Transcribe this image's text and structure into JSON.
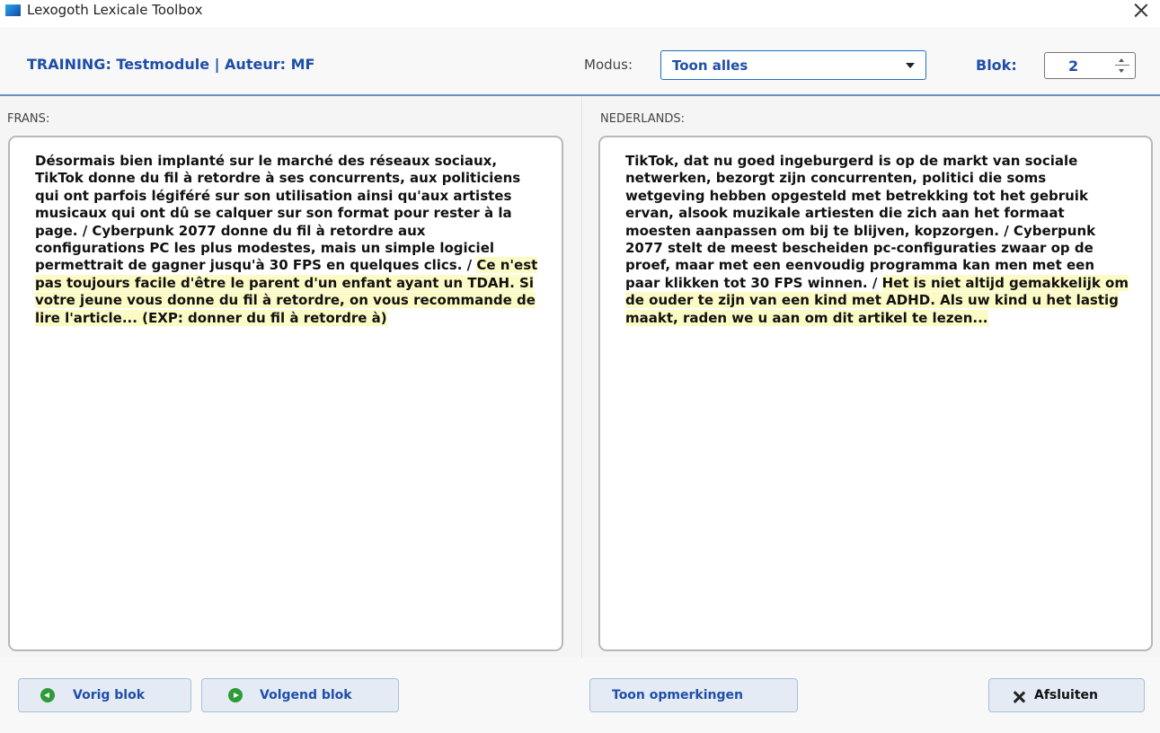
{
  "window": {
    "title": "Lexogoth Lexicale Toolbox"
  },
  "header": {
    "title": "TRAINING: Testmodule | Auteur: MF",
    "modus_label": "Modus:",
    "modus_value": "Toon alles",
    "blok_label": "Blok:",
    "blok_value": "2"
  },
  "panes": {
    "french": {
      "label": "FRANS:",
      "text_plain": "Désormais bien implanté sur le marché des réseaux sociaux, TikTok donne du fil à retordre à ses concurrents, aux politiciens qui ont parfois légiféré sur son utilisation ainsi qu'aux artistes musicaux qui ont dû se calquer sur son format pour rester à la page. / Cyberpunk 2077 donne du fil à retordre aux configurations PC les plus modestes, mais un simple logiciel permettrait de gagner jusqu'à 30 FPS en quelques clics. /",
      "text_highlighted": "Ce n'est pas toujours facile d'être le parent d'un enfant ayant un TDAH. Si votre jeune vous donne du fil à retordre, on vous recommande de lire l'article... (EXP: donner du fil à retordre à)"
    },
    "dutch": {
      "label": "NEDERLANDS:",
      "text_plain": "TikTok, dat nu goed ingeburgerd is op de markt van sociale netwerken, bezorgt zijn concurrenten, politici die soms wetgeving hebben opgesteld met betrekking tot het gebruik ervan, alsook muzikale artiesten die zich aan het formaat moesten aanpassen om bij te blijven, kopzorgen. / Cyberpunk 2077 stelt de meest bescheiden pc-configuraties zwaar op de proef, maar met een eenvoudig programma kan men met een paar klikken tot 30 FPS winnen. /",
      "text_highlighted": "Het is niet altijd gemakkelijk om de ouder te zijn van een kind met ADHD. Als uw kind u het lastig maakt, raden we u aan om dit artikel te lezen..."
    }
  },
  "footer": {
    "prev_label": "Vorig blok",
    "next_label": "Volgend blok",
    "remarks_label": "Toon opmerkingen",
    "close_label": "Afsluiten"
  },
  "colors": {
    "accent": "#1f4ea8",
    "highlight": "#fdfbc5",
    "nav_icon": "#2e9b38",
    "button_bg": "#e4ebf5"
  },
  "icons": [
    "app-icon",
    "close-icon",
    "arrow-left-icon",
    "arrow-right-icon",
    "x-icon",
    "chevron-down-icon"
  ]
}
